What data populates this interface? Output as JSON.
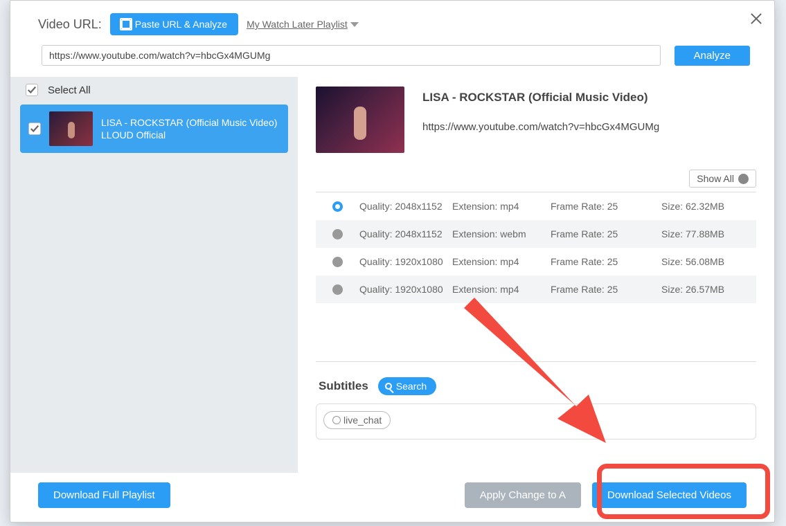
{
  "labels": {
    "urlLabel": "Video URL:",
    "pasteAnalyze": "Paste URL & Analyze",
    "watchLater": "My Watch Later Playlist",
    "analyze": "Analyze",
    "selectAll": "Select All",
    "showAll": "Show All",
    "subtitles": "Subtitles",
    "search": "Search",
    "downloadFull": "Download Full Playlist",
    "applyChange": "Apply Change to A",
    "downloadSelected": "Download Selected Videos"
  },
  "url": "https://www.youtube.com/watch?v=hbcGx4MGUMg",
  "videoList": [
    {
      "title": "LISA - ROCKSTAR (Official Music Video)",
      "sub": "LLOUD Official",
      "checked": true
    }
  ],
  "current": {
    "title": "LISA - ROCKSTAR (Official Music Video)",
    "url": "https://www.youtube.com/watch?v=hbcGx4MGUMg"
  },
  "formats": [
    {
      "selected": true,
      "quality": "Quality: 2048x1152",
      "ext": "Extension: mp4",
      "fr": "Frame Rate: 25",
      "size": "Size: 62.32MB"
    },
    {
      "selected": false,
      "quality": "Quality: 2048x1152",
      "ext": "Extension: webm",
      "fr": "Frame Rate: 25",
      "size": "Size: 77.88MB"
    },
    {
      "selected": false,
      "quality": "Quality: 1920x1080",
      "ext": "Extension: mp4",
      "fr": "Frame Rate: 25",
      "size": "Size: 56.08MB"
    },
    {
      "selected": false,
      "quality": "Quality: 1920x1080",
      "ext": "Extension: mp4",
      "fr": "Frame Rate: 25",
      "size": "Size: 26.57MB"
    }
  ],
  "subtitleOptions": [
    {
      "label": "live_chat"
    }
  ]
}
